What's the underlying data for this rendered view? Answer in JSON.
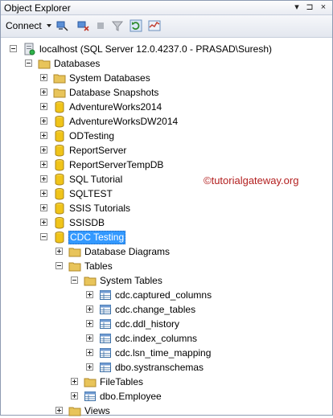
{
  "panel": {
    "title": "Object Explorer",
    "pin_glyph": "▾",
    "pin2_glyph": "⊐",
    "close_glyph": "×"
  },
  "toolbar": {
    "connect_label": "Connect"
  },
  "tree": {
    "server": "localhost (SQL Server 12.0.4237.0 - PRASAD\\Suresh)",
    "databases": "Databases",
    "system_databases": "System Databases",
    "database_snapshots": "Database Snapshots",
    "db_items": [
      "AdventureWorks2014",
      "AdventureWorksDW2014",
      "ODTesting",
      "ReportServer",
      "ReportServerTempDB",
      "SQL Tutorial",
      "SQLTEST",
      "SSIS Tutorials",
      "SSISDB"
    ],
    "cdc_testing": "CDC Testing",
    "database_diagrams": "Database Diagrams",
    "tables": "Tables",
    "system_tables": "System Tables",
    "system_table_items": [
      "cdc.captured_columns",
      "cdc.change_tables",
      "cdc.ddl_history",
      "cdc.index_columns",
      "cdc.lsn_time_mapping",
      "dbo.systranschemas"
    ],
    "file_tables": "FileTables",
    "dbo_employee": "dbo.Employee",
    "views": "Views"
  },
  "watermark": "©tutorialgateway.org",
  "colors": {
    "selection": "#3399ff",
    "folder": "#e8c45a",
    "database": "#f0c419",
    "watermark": "#b31f1f"
  }
}
